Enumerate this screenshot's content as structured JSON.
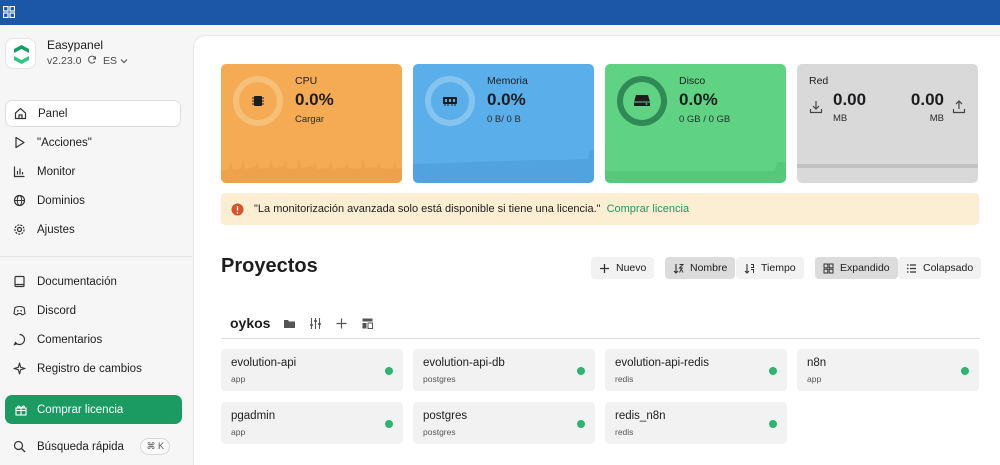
{
  "colors": {
    "topbar": "#1b57a6",
    "cpu": "#f5ab54",
    "memory": "#5aaeea",
    "disk": "#5fd383",
    "network": "#d9d9d9",
    "accent": "#1b9b62",
    "status_ok": "#2fb36e"
  },
  "brand": {
    "name": "Easypanel",
    "version": "v2.23.0",
    "language": "ES"
  },
  "nav": [
    {
      "label": "Panel",
      "icon": "home-icon"
    },
    {
      "label": "\"Acciones\"",
      "icon": "play-icon"
    },
    {
      "label": "Monitor",
      "icon": "bar-chart-icon"
    },
    {
      "label": "Dominios",
      "icon": "globe-icon"
    },
    {
      "label": "Ajustes",
      "icon": "gear-icon"
    },
    {
      "label": "Documentación",
      "icon": "book-icon"
    },
    {
      "label": "Discord",
      "icon": "discord-icon"
    },
    {
      "label": "Comentarios",
      "icon": "comment-icon"
    },
    {
      "label": "Registro de cambios",
      "icon": "sparkle-icon"
    }
  ],
  "buy_label": "Comprar licencia",
  "search": {
    "label": "Búsqueda rápida",
    "shortcut": "⌘ K"
  },
  "stats": {
    "cpu": {
      "label": "CPU",
      "value": "0.0%",
      "sub": "Cargar"
    },
    "memory": {
      "label": "Memoria",
      "value": "0.0%",
      "sub": "0 B/ 0 B"
    },
    "disk": {
      "label": "Disco",
      "value": "0.0%",
      "sub": "0 GB / 0 GB"
    },
    "network": {
      "label": "Red",
      "in_value": "0.00",
      "in_unit": "MB",
      "out_value": "0.00",
      "out_unit": "MB"
    }
  },
  "alert": {
    "text": "\"La monitorización avanzada solo está disponible si tiene una licencia.\"",
    "link": "Comprar licencia"
  },
  "projects": {
    "title": "Proyectos",
    "new_label": "Nuevo",
    "sort_name": "Nombre",
    "sort_time": "Tiempo",
    "view_expanded": "Expandido",
    "view_collapsed": "Colapsado",
    "group": {
      "name": "oykos",
      "services": [
        {
          "name": "evolution-api",
          "type": "app"
        },
        {
          "name": "evolution-api-db",
          "type": "postgres"
        },
        {
          "name": "evolution-api-redis",
          "type": "redis"
        },
        {
          "name": "n8n",
          "type": "app"
        },
        {
          "name": "pgadmin",
          "type": "app"
        },
        {
          "name": "postgres",
          "type": "postgres"
        },
        {
          "name": "redis_n8n",
          "type": "redis"
        }
      ]
    }
  }
}
